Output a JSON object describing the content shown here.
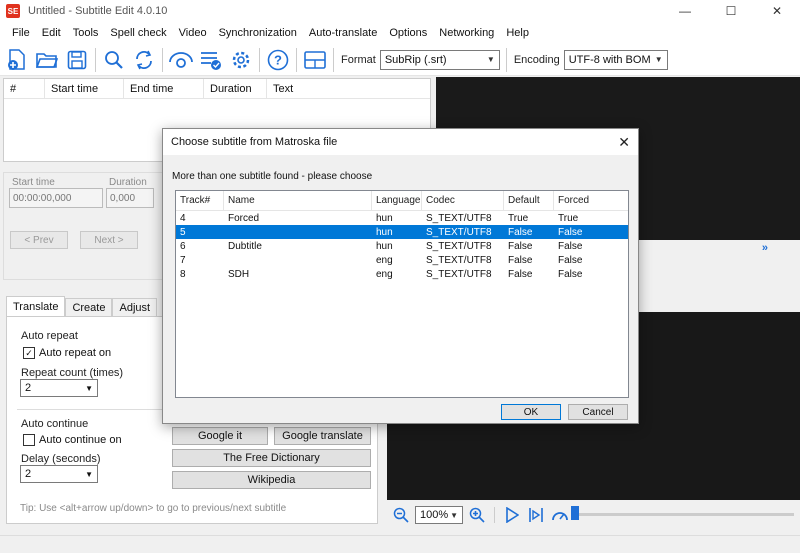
{
  "window": {
    "title": "Untitled - Subtitle Edit 4.0.10",
    "app_icon_text": "SE",
    "minimize": "—",
    "maximize": "☐",
    "close": "✕"
  },
  "menu": [
    "File",
    "Edit",
    "Tools",
    "Spell check",
    "Video",
    "Synchronization",
    "Auto-translate",
    "Options",
    "Networking",
    "Help"
  ],
  "toolbar": {
    "icons": [
      "new-file-icon",
      "open-folder-icon",
      "save-icon",
      "find-icon",
      "replace-icon",
      "visual-sync-icon",
      "spell-check-icon",
      "settings-icon",
      "help-icon",
      "layout-icon"
    ],
    "format_label": "Format",
    "format_value": "SubRip (.srt)",
    "encoding_label": "Encoding",
    "encoding_value": "UTF-8 with BOM"
  },
  "grid": {
    "columns": [
      "#",
      "Start time",
      "End time",
      "Duration",
      "Text"
    ]
  },
  "edit": {
    "start_time_label": "Start time",
    "start_time_value": "00:00:00,000",
    "duration_label": "Duration",
    "duration_value": "0,000",
    "prev_button": "< Prev",
    "next_button": "Next >"
  },
  "tabs": [
    "Translate",
    "Create",
    "Adjust"
  ],
  "translate_panel": {
    "auto_repeat_title": "Auto repeat",
    "auto_repeat_on_label": "Auto repeat on",
    "auto_repeat_on_checked": true,
    "repeat_count_label": "Repeat count (times)",
    "repeat_count_value": "2",
    "auto_continue_title": "Auto continue",
    "auto_continue_on_label": "Auto continue on",
    "auto_continue_on_checked": false,
    "delay_label": "Delay (seconds)",
    "delay_value": "2",
    "google_it": "Google it",
    "google_translate": "Google translate",
    "free_dictionary": "The Free Dictionary",
    "wikipedia": "Wikipedia"
  },
  "tip": "Tip: Use <alt+arrow up/down> to go to previous/next subtitle",
  "video": {
    "zoom_value": "100%",
    "wave_arrows": "»"
  },
  "dialog": {
    "title": "Choose subtitle from Matroska file",
    "close": "✕",
    "message": "More than one subtitle found - please choose",
    "columns": [
      "Track#",
      "Name",
      "Language",
      "Codec",
      "Default",
      "Forced"
    ],
    "rows": [
      {
        "track": "4",
        "name": "Forced",
        "language": "hun",
        "codec": "S_TEXT/UTF8",
        "default": "True",
        "forced": "True",
        "selected": false
      },
      {
        "track": "5",
        "name": "",
        "language": "hun",
        "codec": "S_TEXT/UTF8",
        "default": "False",
        "forced": "False",
        "selected": true
      },
      {
        "track": "6",
        "name": "Dubtitle",
        "language": "hun",
        "codec": "S_TEXT/UTF8",
        "default": "False",
        "forced": "False",
        "selected": false
      },
      {
        "track": "7",
        "name": "",
        "language": "eng",
        "codec": "S_TEXT/UTF8",
        "default": "False",
        "forced": "False",
        "selected": false
      },
      {
        "track": "8",
        "name": "SDH",
        "language": "eng",
        "codec": "S_TEXT/UTF8",
        "default": "False",
        "forced": "False",
        "selected": false
      }
    ],
    "ok": "OK",
    "cancel": "Cancel"
  }
}
